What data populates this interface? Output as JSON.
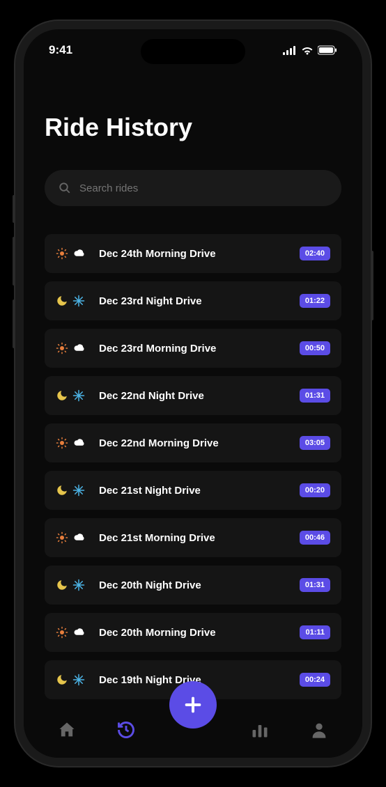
{
  "status_bar": {
    "time": "9:41"
  },
  "page_title": "Ride History",
  "search": {
    "placeholder": "Search rides"
  },
  "colors": {
    "accent": "#5b4ce6",
    "sun": "#e67e3c",
    "moon": "#e6c54c",
    "cloud": "#ffffff",
    "snow": "#4cb4e6"
  },
  "rides": [
    {
      "time_of_day": "morning",
      "weather": "cloud",
      "title": "Dec 24th Morning Drive",
      "duration": "02:40"
    },
    {
      "time_of_day": "night",
      "weather": "snow",
      "title": "Dec 23rd Night Drive",
      "duration": "01:22"
    },
    {
      "time_of_day": "morning",
      "weather": "cloud",
      "title": "Dec 23rd Morning Drive",
      "duration": "00:50"
    },
    {
      "time_of_day": "night",
      "weather": "snow",
      "title": "Dec 22nd Night Drive",
      "duration": "01:31"
    },
    {
      "time_of_day": "morning",
      "weather": "cloud",
      "title": "Dec 22nd Morning Drive",
      "duration": "03:05"
    },
    {
      "time_of_day": "night",
      "weather": "snow",
      "title": "Dec 21st Night Drive",
      "duration": "00:20"
    },
    {
      "time_of_day": "morning",
      "weather": "cloud",
      "title": "Dec 21st Morning Drive",
      "duration": "00:46"
    },
    {
      "time_of_day": "night",
      "weather": "snow",
      "title": "Dec 20th Night Drive",
      "duration": "01:31"
    },
    {
      "time_of_day": "morning",
      "weather": "cloud",
      "title": "Dec 20th Morning Drive",
      "duration": "01:11"
    },
    {
      "time_of_day": "night",
      "weather": "snow",
      "title": "Dec 19th Night Drive",
      "duration": "00:24"
    }
  ],
  "nav": {
    "active": "history"
  }
}
